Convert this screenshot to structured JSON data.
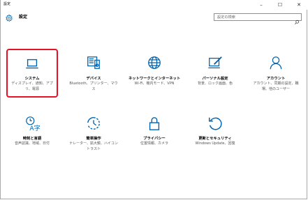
{
  "window": {
    "title": "設定",
    "controls": {
      "minimize": "–",
      "maximize": "☐",
      "close": "✕"
    }
  },
  "header": {
    "title": "設定",
    "search_placeholder": "設定の検索"
  },
  "tiles": [
    {
      "label": "システム",
      "desc": "ディスプレイ、通知、アプリ、電源",
      "icon": "laptop-icon",
      "selected": true
    },
    {
      "label": "デバイス",
      "desc": "Bluetooth、プリンター、マウス",
      "icon": "devices-icon",
      "selected": false
    },
    {
      "label": "ネットワークとインターネット",
      "desc": "Wi-Fi、機内モード、VPN",
      "icon": "globe-icon",
      "selected": false
    },
    {
      "label": "パーソナル設定",
      "desc": "背景、ロック画面、色",
      "icon": "personalization-icon",
      "selected": false
    },
    {
      "label": "アカウント",
      "desc": "アカウント、同期の設定、職場、他のユーザー",
      "icon": "person-icon",
      "selected": false
    },
    {
      "label": "時刻と言語",
      "desc": "音声認識、地域、日付",
      "icon": "time-language-icon",
      "selected": false
    },
    {
      "label": "簡単操作",
      "desc": "ナレーター、拡大鏡、ハイコントラスト",
      "icon": "ease-of-access-icon",
      "selected": false
    },
    {
      "label": "プライバシー",
      "desc": "位置情報、カメラ",
      "icon": "lock-icon",
      "selected": false
    },
    {
      "label": "更新とセキュリティ",
      "desc": "Windows Update、回復",
      "icon": "update-icon",
      "selected": false
    }
  ],
  "colors": {
    "accent": "#0063b1",
    "selection": "#e81123"
  }
}
